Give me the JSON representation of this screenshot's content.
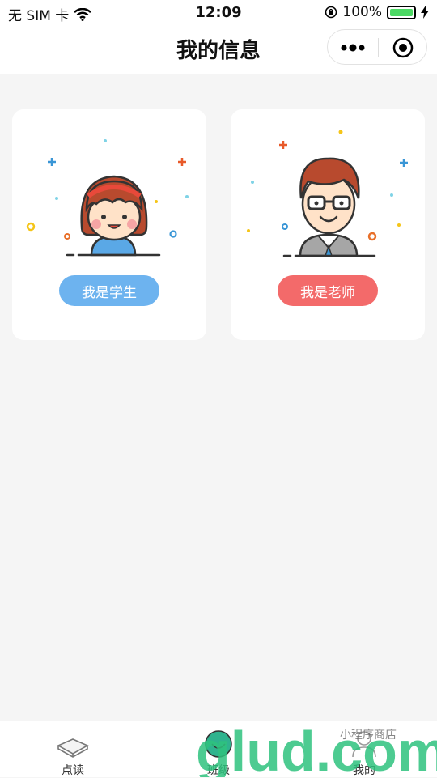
{
  "status_bar": {
    "carrier": "无 SIM 卡",
    "time": "12:09",
    "battery": "100%"
  },
  "nav": {
    "title": "我的信息"
  },
  "roles": [
    {
      "label": "我是学生",
      "color": "#6db3ef"
    },
    {
      "label": "我是老师",
      "color": "#f36a6a"
    }
  ],
  "tabs": [
    {
      "label": "点读"
    },
    {
      "label": "班级"
    },
    {
      "label": "我的"
    }
  ],
  "watermark": {
    "text": "glud.com",
    "subtext": "小程序商店"
  }
}
